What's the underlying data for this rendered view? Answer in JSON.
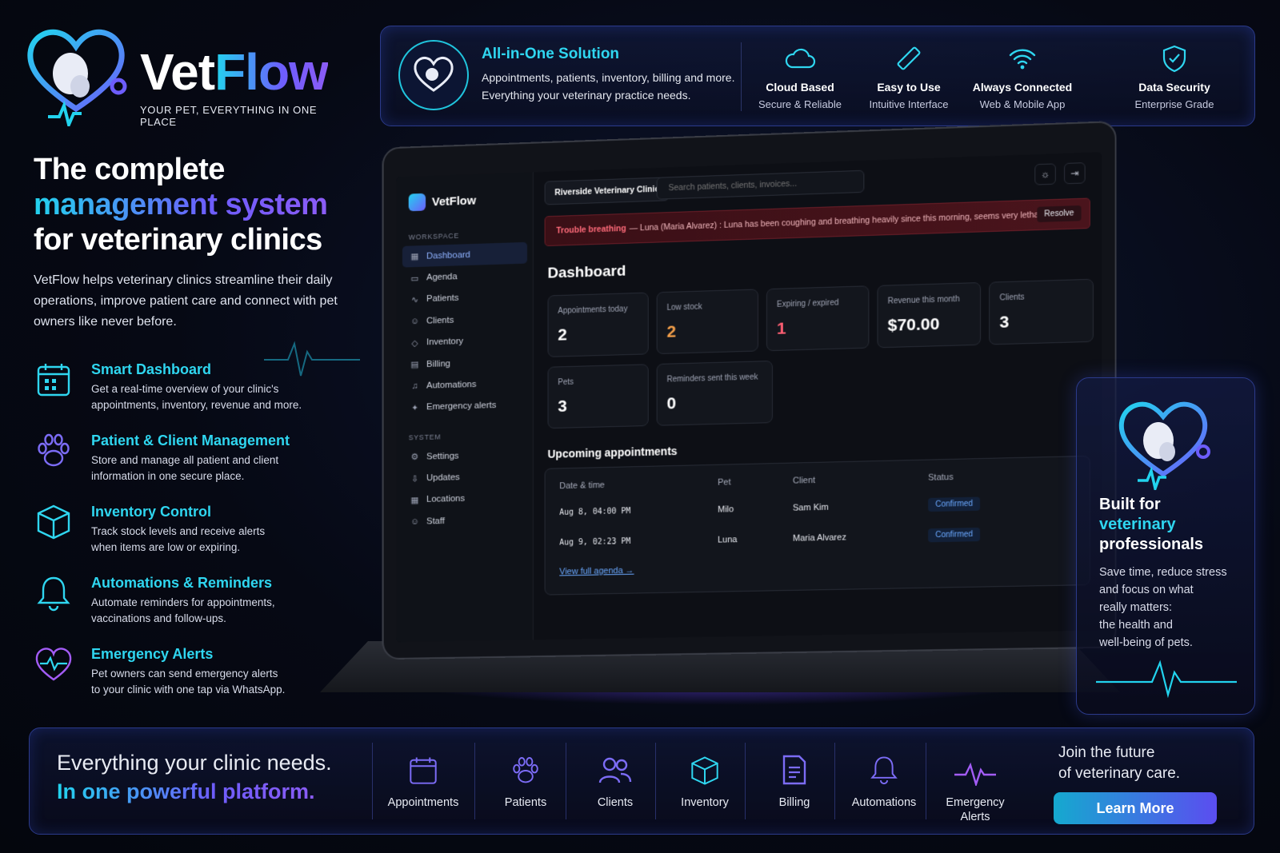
{
  "brand": {
    "name_a": "Vet",
    "name_b": "Flow",
    "tagline": "YOUR PET, EVERYTHING IN ONE PLACE"
  },
  "topbar": {
    "title": "All-in-One Solution",
    "desc1": "Appointments, patients, inventory, billing and more.",
    "desc2": "Everything your veterinary practice needs.",
    "features": [
      {
        "icon": "cloud-icon",
        "title": "Cloud Based",
        "sub": "Secure & Reliable"
      },
      {
        "icon": "pencil-icon",
        "title": "Easy to Use",
        "sub": "Intuitive Interface"
      },
      {
        "icon": "wifi-icon",
        "title": "Always Connected",
        "sub": "Web & Mobile App"
      },
      {
        "icon": "shield-check-icon",
        "title": "Data Security",
        "sub": "Enterprise Grade"
      }
    ]
  },
  "headline": {
    "l1": "The complete",
    "l2": "management system",
    "l3": "for veterinary clinics"
  },
  "intro": "VetFlow helps veterinary clinics streamline their daily operations, improve patient care and connect with pet owners like never before.",
  "features": [
    {
      "icon": "calendar-icon",
      "title": "Smart Dashboard",
      "d1": "Get a real-time overview of your clinic's",
      "d2": "appointments, inventory, revenue and more."
    },
    {
      "icon": "paw-icon",
      "title": "Patient & Client Management",
      "d1": "Store and manage all patient and client",
      "d2": "information in one secure place."
    },
    {
      "icon": "box-icon",
      "title": "Inventory Control",
      "d1": "Track stock levels and receive alerts",
      "d2": "when items are low or expiring."
    },
    {
      "icon": "bell-icon",
      "title": "Automations & Reminders",
      "d1": "Automate reminders for appointments,",
      "d2": "vaccinations and follow-ups."
    },
    {
      "icon": "heart-pulse-icon",
      "title": "Emergency Alerts",
      "d1": "Pet owners can send emergency alerts",
      "d2": "to your clinic with one tap via WhatsApp."
    }
  ],
  "app": {
    "brand": "VetFlow",
    "workspace_label": "WORKSPACE",
    "system_label": "SYSTEM",
    "nav": [
      {
        "icon": "grid-icon",
        "label": "Dashboard",
        "active": true
      },
      {
        "icon": "calendar-icon",
        "label": "Agenda"
      },
      {
        "icon": "pulse-icon",
        "label": "Patients"
      },
      {
        "icon": "user-icon",
        "label": "Clients"
      },
      {
        "icon": "box-icon",
        "label": "Inventory"
      },
      {
        "icon": "document-icon",
        "label": "Billing"
      },
      {
        "icon": "bell-icon",
        "label": "Automations"
      },
      {
        "icon": "sparkle-icon",
        "label": "Emergency alerts"
      }
    ],
    "system_nav": [
      {
        "icon": "gear-icon",
        "label": "Settings"
      },
      {
        "icon": "download-icon",
        "label": "Updates"
      },
      {
        "icon": "grid-icon",
        "label": "Locations"
      },
      {
        "icon": "user-icon",
        "label": "Staff"
      }
    ],
    "clinic": "Riverside Veterinary Clinic",
    "search_placeholder": "Search patients, clients, invoices...",
    "alert": {
      "title": "Trouble breathing",
      "text": "— Luna (Maria Alvarez) : Luna has been coughing and breathing heavily since this morning, seems very lethargic.",
      "action": "Resolve"
    },
    "dashboard_title": "Dashboard",
    "stats": [
      {
        "label": "Appointments today",
        "value": "2",
        "color": "#ffffff"
      },
      {
        "label": "Low stock",
        "value": "2",
        "color": "#f5a04a"
      },
      {
        "label": "Expiring / expired",
        "value": "1",
        "color": "#ff5f73"
      },
      {
        "label": "Revenue this month",
        "value": "$70.00",
        "color": "#ffffff"
      },
      {
        "label": "Clients",
        "value": "3",
        "color": "#ffffff"
      },
      {
        "label": "Pets",
        "value": "3",
        "color": "#ffffff"
      },
      {
        "label": "Reminders sent this week",
        "value": "0",
        "color": "#ffffff"
      }
    ],
    "upcoming_title": "Upcoming appointments",
    "table": {
      "headers": [
        "Date & time",
        "Pet",
        "Client",
        "Status"
      ],
      "rows": [
        {
          "date": "Aug 8, 04:00 PM",
          "pet": "Milo",
          "client": "Sam Kim",
          "status": "Confirmed"
        },
        {
          "date": "Aug 9, 02:23 PM",
          "pet": "Luna",
          "client": "Maria Alvarez",
          "status": "Confirmed"
        }
      ],
      "link": "View full agenda →"
    }
  },
  "right_card": {
    "h1": "Built for",
    "h2": "veterinary",
    "h3": "professionals",
    "b1": "Save time, reduce stress",
    "b2": "and focus on what",
    "b3": "really matters:",
    "b4": "the health and",
    "b5": "well-being of pets."
  },
  "bottom": {
    "s1": "Everything your clinic needs.",
    "s2": "In one powerful platform.",
    "items": [
      {
        "icon": "calendar-icon",
        "label": "Appointments"
      },
      {
        "icon": "paw-icon",
        "label": "Patients"
      },
      {
        "icon": "users-icon",
        "label": "Clients"
      },
      {
        "icon": "box-icon",
        "label": "Inventory"
      },
      {
        "icon": "document-icon",
        "label": "Billing"
      },
      {
        "icon": "bell-icon",
        "label": "Automations"
      },
      {
        "icon": "pulse-icon",
        "label": "Emergency Alerts"
      }
    ],
    "join1": "Join the future",
    "join2": "of veterinary care.",
    "cta": "Learn More"
  }
}
